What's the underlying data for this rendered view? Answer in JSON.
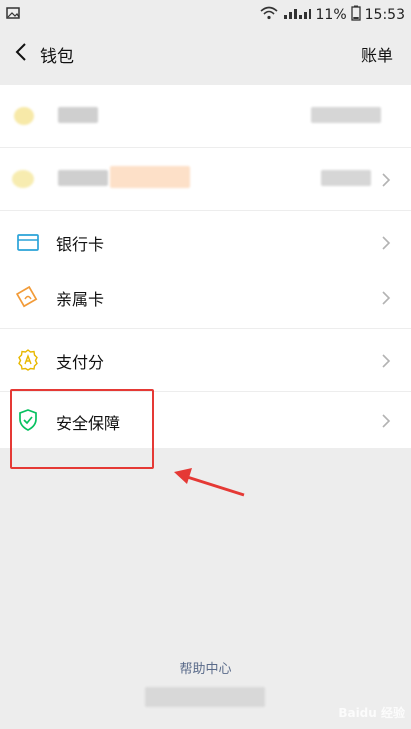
{
  "status": {
    "battery": "11%",
    "time": "15:53"
  },
  "nav": {
    "title": "钱包",
    "action": "账单"
  },
  "sections": {
    "cards": [
      {
        "label": "银行卡"
      }
    ],
    "services": [
      {
        "label": "亲属卡"
      },
      {
        "label": "支付分"
      }
    ],
    "security": [
      {
        "label": "安全保障"
      }
    ]
  },
  "footer": {
    "help": "帮助中心"
  },
  "watermark": "Baidu 经验",
  "colors": {
    "accent_red": "#e53935",
    "icon_blue": "#2aa3d8",
    "icon_orange": "#f29b38",
    "icon_yellow": "#f1c40f",
    "icon_green": "#07c160"
  }
}
